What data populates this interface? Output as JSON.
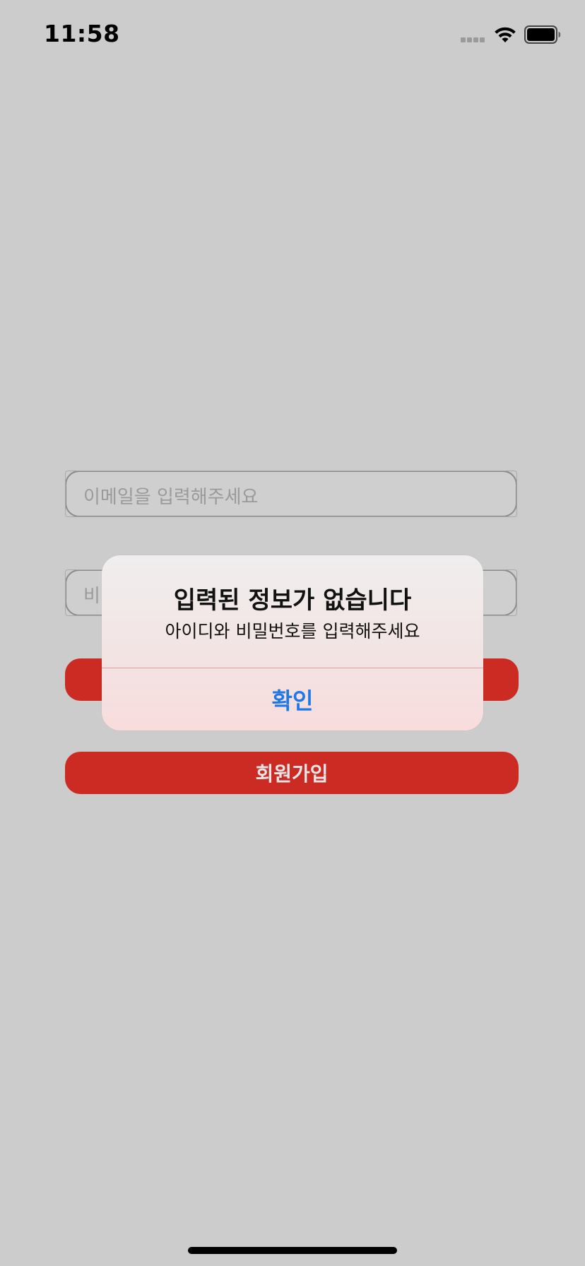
{
  "status_bar": {
    "time": "11:58",
    "icons": [
      "signal-icon",
      "wifi-icon",
      "battery-icon"
    ]
  },
  "form": {
    "email_placeholder": "이메일을 입력해주세요",
    "password_placeholder_visible": "비",
    "login_label": "",
    "signup_label": "회원가입"
  },
  "alert": {
    "title": "입력된 정보가 없습니다",
    "message": "아이디와 비밀번호를 입력해주세요",
    "confirm_label": "확인"
  },
  "colors": {
    "background": "#cccccc",
    "button_red": "#cc2b24",
    "alert_action_blue": "#1f78e8"
  }
}
